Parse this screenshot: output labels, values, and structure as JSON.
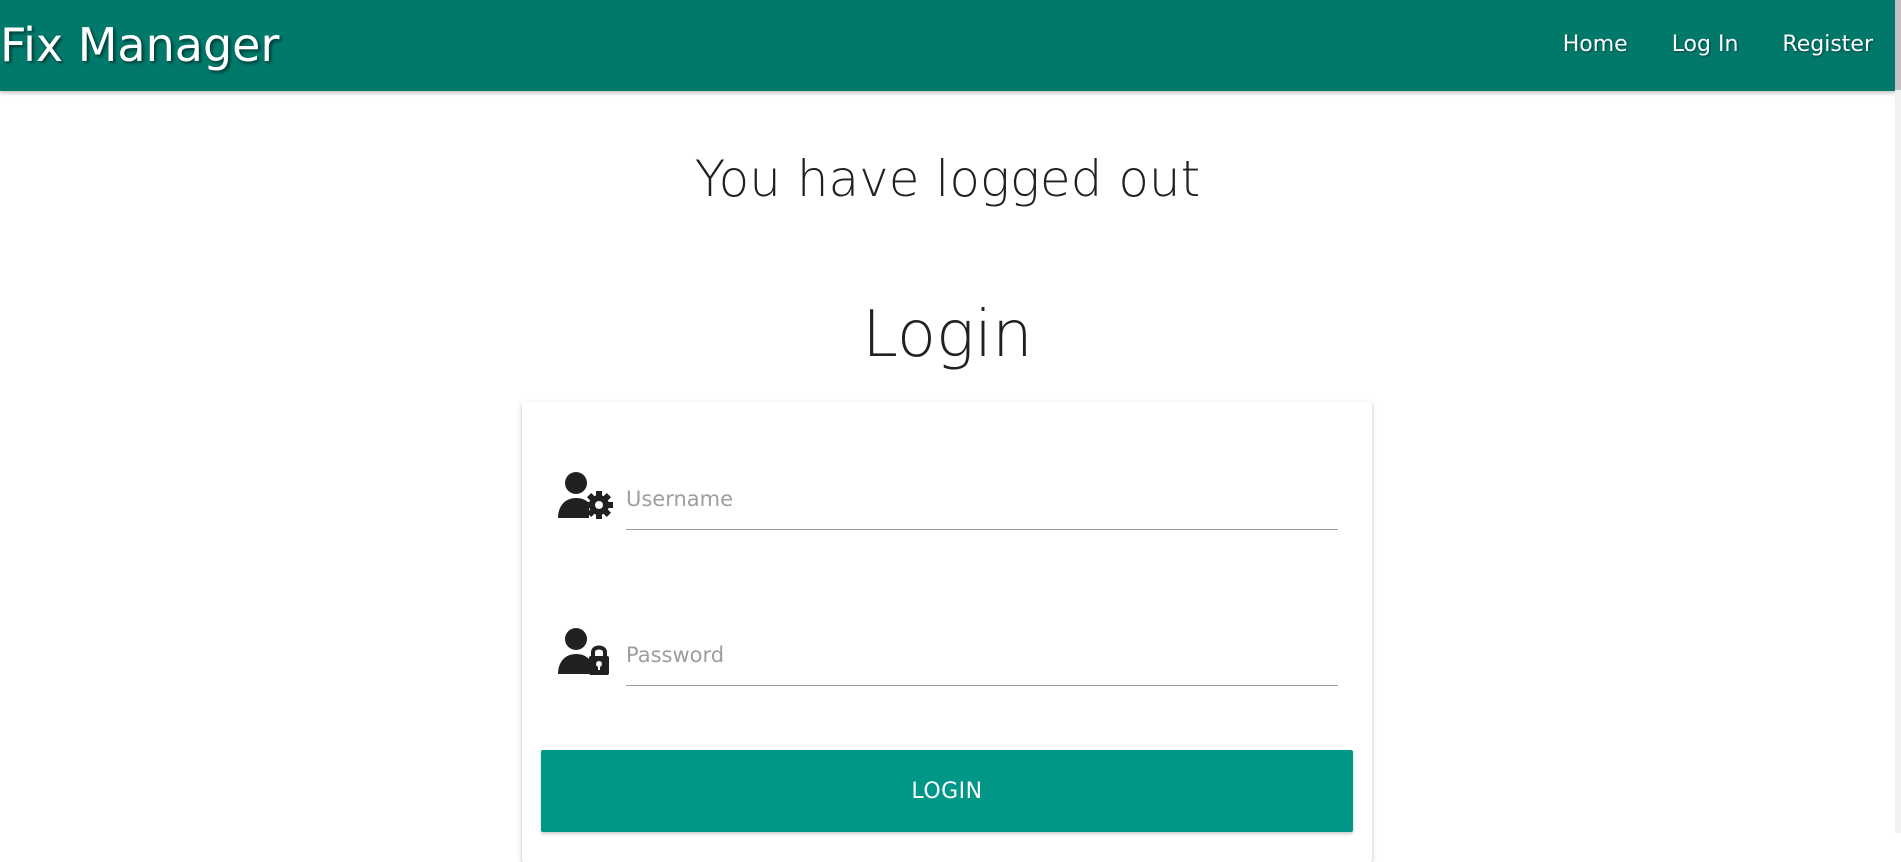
{
  "navbar": {
    "brand": "Fix Manager",
    "links": [
      {
        "label": "Home"
      },
      {
        "label": "Log In"
      },
      {
        "label": "Register"
      }
    ],
    "color": "#00796b"
  },
  "main": {
    "logout_message": "You have logged out",
    "login_title": "Login"
  },
  "login_form": {
    "username": {
      "placeholder": "Username",
      "value": "",
      "icon": "user-gear-icon"
    },
    "password": {
      "placeholder": "Password",
      "value": "",
      "icon": "user-lock-icon"
    },
    "submit_label": "LOGIN",
    "button_color": "#009688"
  }
}
